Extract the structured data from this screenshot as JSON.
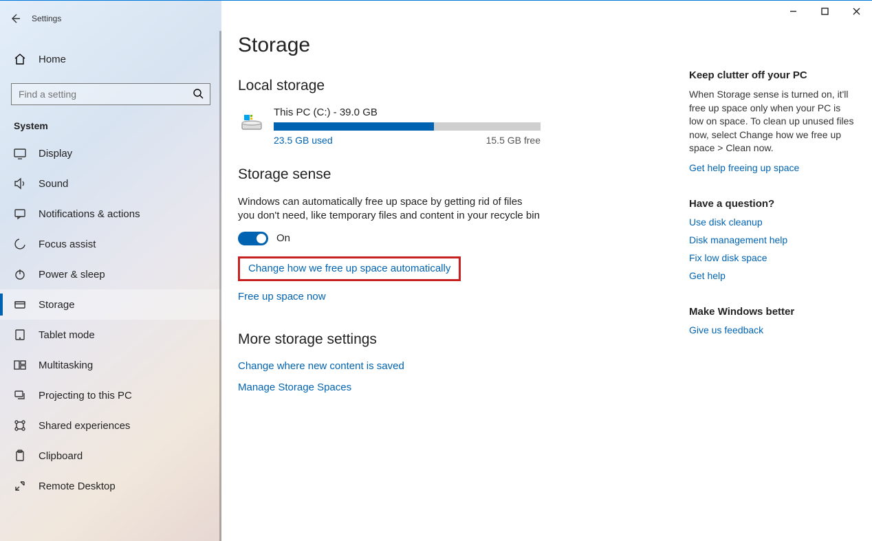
{
  "app_title": "Settings",
  "home_label": "Home",
  "search_placeholder": "Find a setting",
  "category_label": "System",
  "nav": [
    {
      "label": "Display"
    },
    {
      "label": "Sound"
    },
    {
      "label": "Notifications & actions"
    },
    {
      "label": "Focus assist"
    },
    {
      "label": "Power & sleep"
    },
    {
      "label": "Storage"
    },
    {
      "label": "Tablet mode"
    },
    {
      "label": "Multitasking"
    },
    {
      "label": "Projecting to this PC"
    },
    {
      "label": "Shared experiences"
    },
    {
      "label": "Clipboard"
    },
    {
      "label": "Remote Desktop"
    }
  ],
  "page_title": "Storage",
  "local_storage": {
    "heading": "Local storage",
    "disk_name": "This PC (C:) - 39.0 GB",
    "used_label": "23.5 GB used",
    "free_label": "15.5 GB free",
    "used_percent": 60
  },
  "storage_sense": {
    "heading": "Storage sense",
    "description": "Windows can automatically free up space by getting rid of files you don't need, like temporary files and content in your recycle bin",
    "toggle_state": "On",
    "change_link": "Change how we free up space automatically",
    "free_now_link": "Free up space now"
  },
  "more_settings": {
    "heading": "More storage settings",
    "change_content_link": "Change where new content is saved",
    "manage_spaces_link": "Manage Storage Spaces"
  },
  "right": {
    "clutter_heading": "Keep clutter off your PC",
    "clutter_text": "When Storage sense is turned on, it'll free up space only when your PC is low on space. To clean up unused files now, select Change how we free up space > Clean now.",
    "clutter_link": "Get help freeing up space",
    "question_heading": "Have a question?",
    "q_links": [
      "Use disk cleanup",
      "Disk management help",
      "Fix low disk space",
      "Get help"
    ],
    "better_heading": "Make Windows better",
    "better_link": "Give us feedback"
  }
}
